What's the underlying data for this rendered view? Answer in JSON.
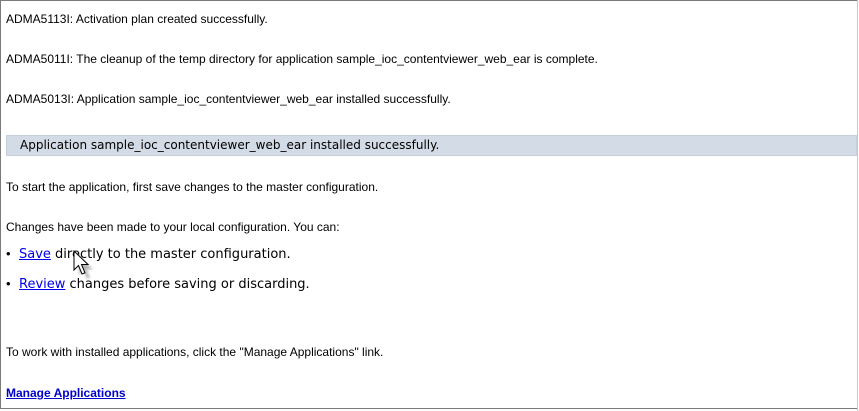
{
  "messages": [
    "ADMA5113I: Activation plan created successfully.",
    "ADMA5011I: The cleanup of the temp directory for application sample_ioc_contentviewer_web_ear is complete.",
    "ADMA5013I: Application sample_ioc_contentviewer_web_ear installed successfully."
  ],
  "banner": {
    "text": "Application sample_ioc_contentviewer_web_ear installed successfully."
  },
  "instructions": {
    "start_note": "To start the application, first save changes to the master configuration.",
    "changes_note": "Changes have been made to your local configuration. You can:",
    "bullet": "•",
    "save_link": "Save",
    "save_rest": " directly to the master configuration.",
    "review_link": "Review",
    "review_rest": " changes before saving or discarding.",
    "manage_note": "To work with installed applications, click the \"Manage Applications\" link.",
    "manage_link": "Manage Applications"
  },
  "colors": {
    "banner_bg": "#d3dbe6",
    "link": "#0000ee"
  },
  "icons": {
    "cursor": "mouse-pointer-icon"
  }
}
